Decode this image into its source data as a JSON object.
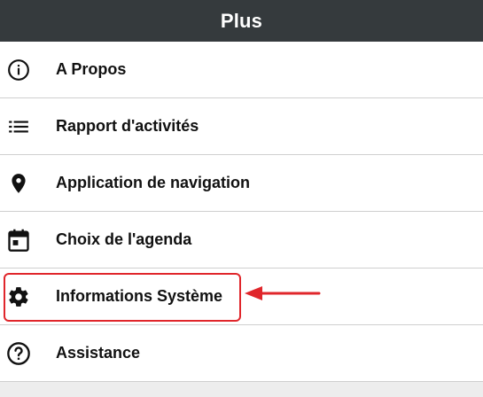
{
  "header": {
    "title": "Plus"
  },
  "menu": {
    "items": [
      {
        "label": "A Propos",
        "icon": "info-circle-icon"
      },
      {
        "label": "Rapport d'activités",
        "icon": "list-icon"
      },
      {
        "label": "Application de navigation",
        "icon": "map-pin-icon"
      },
      {
        "label": "Choix de l'agenda",
        "icon": "calendar-icon"
      },
      {
        "label": "Informations Système",
        "icon": "gear-icon"
      },
      {
        "label": "Assistance",
        "icon": "help-circle-icon"
      }
    ]
  },
  "annotation": {
    "highlighted_item": "Informations Système",
    "color": "#e0262b"
  },
  "colors": {
    "header_bg": "#353a3d",
    "header_text": "#ffffff",
    "item_bg": "#ffffff",
    "divider": "#cfcfcf",
    "page_bg": "#ededed"
  }
}
